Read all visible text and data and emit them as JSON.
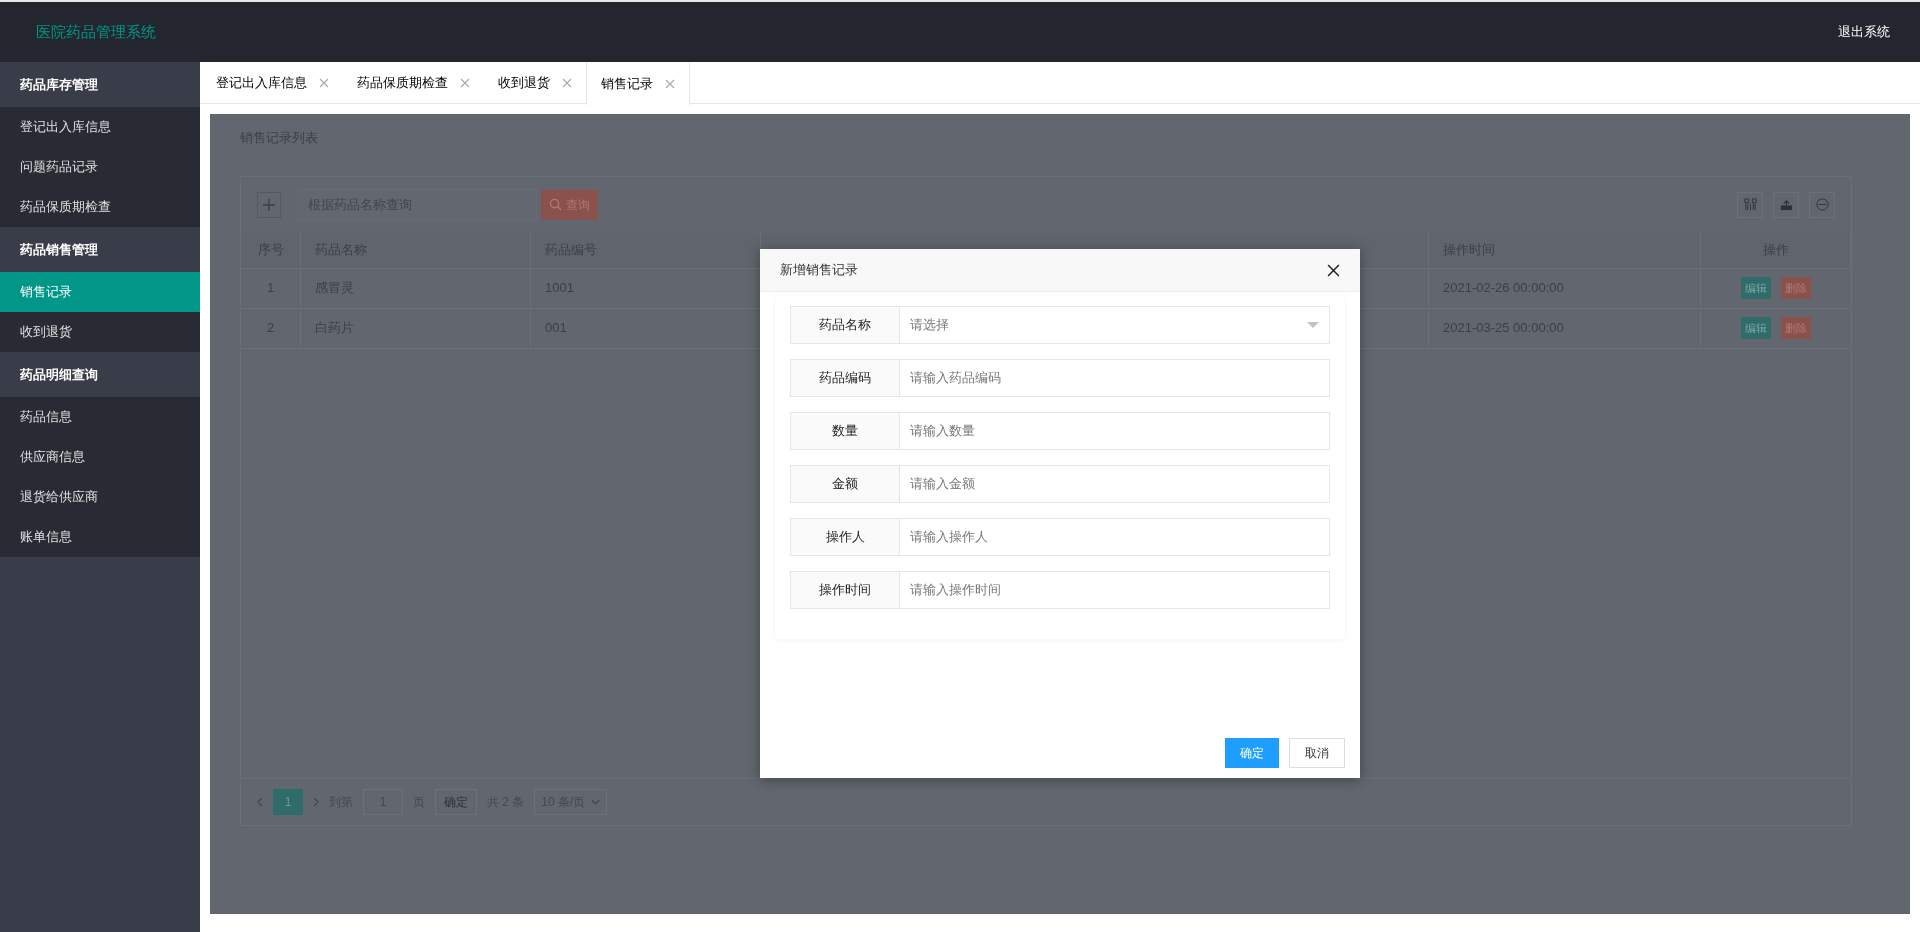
{
  "header": {
    "title": "医院药品管理系统",
    "logout": "退出系统"
  },
  "sidebar": [
    {
      "title": "药品库存管理",
      "items": [
        {
          "label": "登记出入库信息",
          "selected": false
        },
        {
          "label": "问题药品记录",
          "selected": false
        },
        {
          "label": "药品保质期检查",
          "selected": false
        }
      ]
    },
    {
      "title": "药品销售管理",
      "items": [
        {
          "label": "销售记录",
          "selected": true
        },
        {
          "label": "收到退货",
          "selected": false
        }
      ]
    },
    {
      "title": "药品明细查询",
      "items": [
        {
          "label": "药品信息",
          "selected": false
        },
        {
          "label": "供应商信息",
          "selected": false
        },
        {
          "label": "退货给供应商",
          "selected": false
        },
        {
          "label": "账单信息",
          "selected": false
        }
      ]
    }
  ],
  "tabs": [
    {
      "label": "登记出入库信息",
      "selected": false
    },
    {
      "label": "药品保质期检查",
      "selected": false
    },
    {
      "label": "收到退货",
      "selected": false
    },
    {
      "label": "销售记录",
      "selected": true
    }
  ],
  "content": {
    "title": "销售记录列表",
    "search": {
      "placeholder": "根据药品名称查询",
      "button": "查询"
    },
    "table": {
      "columns": [
        "序号",
        "药品名称",
        "药品编号",
        "操作时间",
        "操作"
      ],
      "rows": [
        {
          "cells": [
            "1",
            "感冒灵",
            "1001",
            "2021-02-26 00:00:00"
          ],
          "actions": [
            "编辑",
            "删除"
          ]
        },
        {
          "cells": [
            "2",
            "白药片",
            "001",
            "2021-03-25 00:00:00"
          ],
          "actions": [
            "编辑",
            "删除"
          ]
        }
      ]
    },
    "pagination": {
      "pages": [
        {
          "label": "1",
          "selected": true
        }
      ],
      "goto_label": "到第",
      "goto_value": "1",
      "page_unit": "页",
      "confirm": "确定",
      "total": "共 2 条",
      "page_size": "10 条/页"
    }
  },
  "modal": {
    "title": "新增销售记录",
    "fields": [
      {
        "kind": "select",
        "label": "药品名称",
        "placeholder": "请选择"
      },
      {
        "kind": "text",
        "label": "药品编码",
        "placeholder": "请输入药品编码"
      },
      {
        "kind": "text",
        "label": "数量",
        "placeholder": "请输入数量"
      },
      {
        "kind": "text",
        "label": "金额",
        "placeholder": "请输入金额"
      },
      {
        "kind": "text",
        "label": "操作人",
        "placeholder": "请输入操作人"
      },
      {
        "kind": "text",
        "label": "操作时间",
        "placeholder": "请输入操作时间"
      }
    ],
    "buttons": [
      {
        "label": "确定",
        "kind": "primary"
      },
      {
        "label": "取消",
        "kind": "default"
      }
    ]
  }
}
